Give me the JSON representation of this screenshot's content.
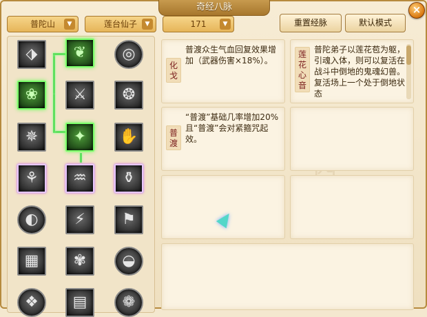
{
  "window": {
    "title": "奇经八脉",
    "close_icon": "×"
  },
  "selectors": {
    "school": "普陀山",
    "sect": "莲台仙子",
    "level": "171",
    "dropdown_glyph": "▼"
  },
  "buttons": {
    "reset": "重置经脉",
    "default_mode": "默认模式"
  },
  "skill_icons": [
    "⬗",
    "❦",
    "◎",
    "❀",
    "⚔",
    "❂",
    "✵",
    "✦",
    "✋",
    "⚘",
    "♒",
    "⚱",
    "◐",
    "⚡",
    "⚑",
    "▦",
    "✾",
    "◒",
    "❖",
    "▤",
    "❁"
  ],
  "cards": {
    "huage": {
      "label": "化戈",
      "text": "普渡众生气血回复效果增加（武器伤害×18%）。"
    },
    "pudu": {
      "label": "普渡",
      "text": "“普渡”基础几率增加20%且“普渡”会对紧箍咒起效。"
    },
    "lianhua": {
      "label": "莲花心音",
      "text": "普陀弟子以莲花苞为躯，引魂入体，则可以复活在战斗中倒地的鬼魂幻兽。复活场上一个处于倒地状态"
    }
  },
  "colors": {
    "frame": "#b68a3e",
    "active_node": "#7bff6a",
    "label_text": "#7a1e1e"
  }
}
